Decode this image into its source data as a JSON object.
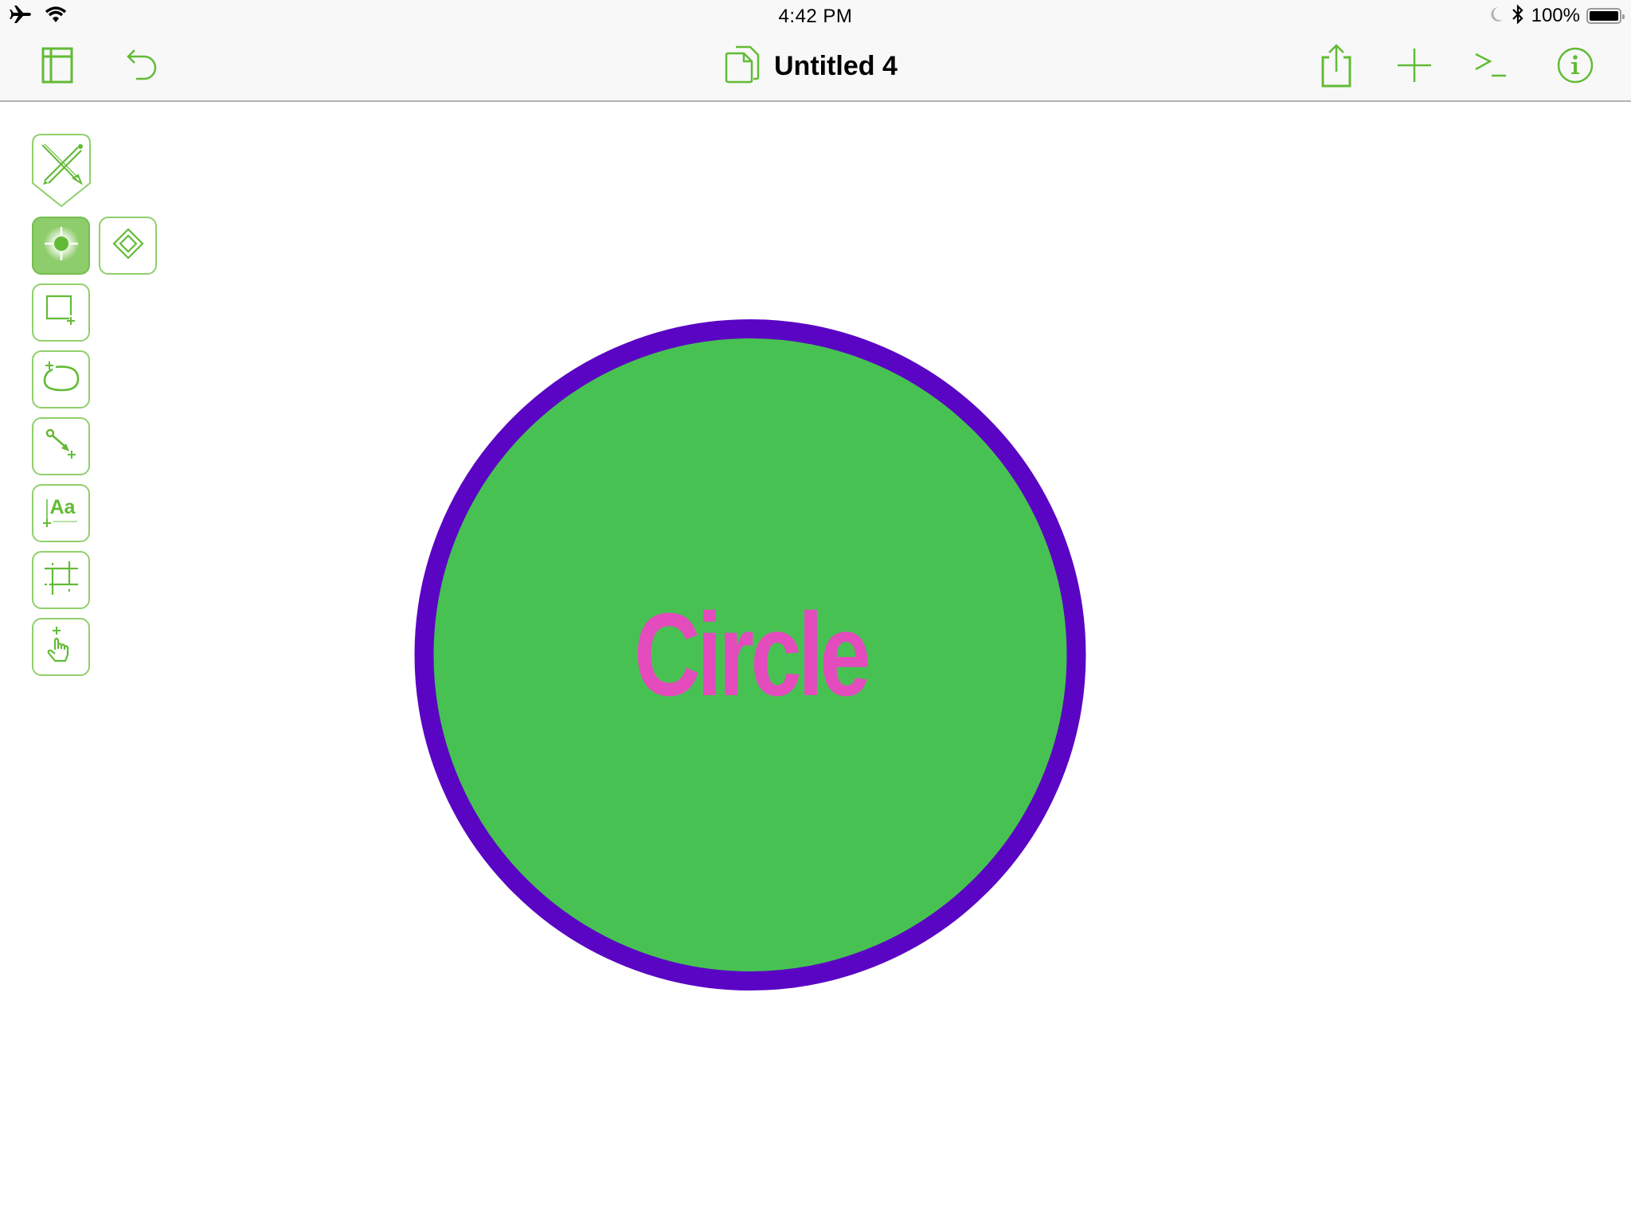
{
  "status_bar": {
    "time": "4:42 PM",
    "battery_percent": "100%",
    "battery_level": 1.0,
    "icons": [
      "airplane-icon",
      "wifi-icon",
      "moon-icon",
      "bluetooth-icon",
      "battery-icon"
    ]
  },
  "navbar": {
    "title": "Untitled 4",
    "left_buttons": [
      "sidebar-toggle",
      "undo"
    ],
    "right_buttons": [
      "share",
      "add",
      "console",
      "info"
    ],
    "accent_color": "#62bb35"
  },
  "tools": {
    "items": [
      {
        "name": "edit-mode",
        "icon": "pen-pencil-icon"
      },
      {
        "name": "selection",
        "icon": "target-icon",
        "active": true
      },
      {
        "name": "point-edit",
        "icon": "diamond-icon"
      },
      {
        "name": "rectangle",
        "icon": "rectangle-icon"
      },
      {
        "name": "ellipse",
        "icon": "ellipse-icon"
      },
      {
        "name": "line",
        "icon": "line-icon"
      },
      {
        "name": "text",
        "icon": "text-icon",
        "glyph": "Aa"
      },
      {
        "name": "magnet",
        "icon": "magnet-grid-icon"
      },
      {
        "name": "browse",
        "icon": "hand-icon"
      }
    ]
  },
  "canvas": {
    "shape": {
      "type": "circle",
      "label": "Circle",
      "fill_color": "#47c252",
      "stroke_color": "#5a05c4",
      "text_color": "#e44bbd"
    }
  }
}
